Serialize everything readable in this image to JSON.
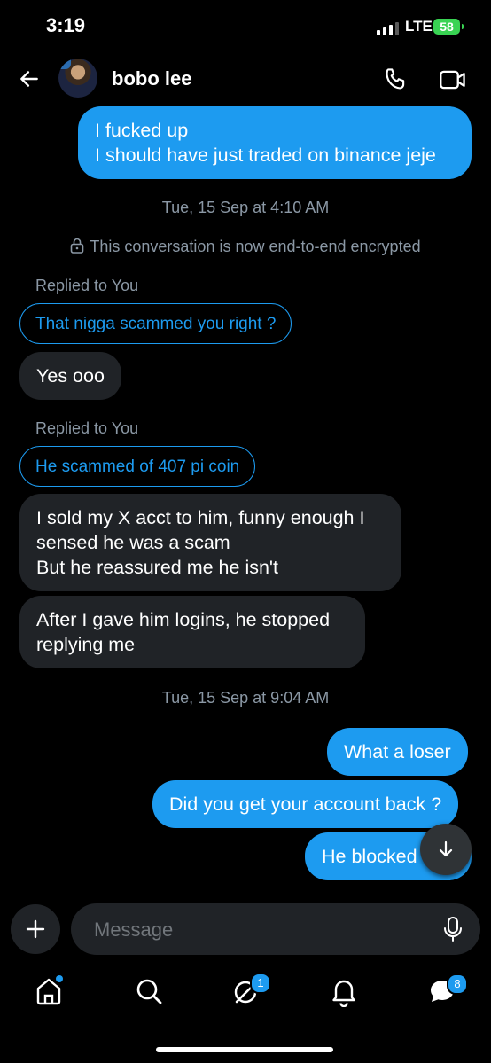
{
  "status": {
    "time": "3:19",
    "network": "LTE",
    "battery": "58"
  },
  "header": {
    "contact_name": "bobo lee"
  },
  "messages": {
    "m1": "I fucked up\nI should have just traded on binance jeje",
    "date1": "Tue, 15 Sep at 4:10 AM",
    "encryption_notice": "This conversation is now end-to-end encrypted",
    "reply1_label": "Replied to You",
    "reply1_quote": "That nigga scammed you right ?",
    "m2": "Yes ooo",
    "reply2_label": "Replied to You",
    "reply2_quote": "He scammed of 407 pi coin",
    "m3": "I sold my X acct to him, funny enough I\nsensed he was a scam\nBut he reassured me he isn't",
    "m4": "After I gave him logins, he stopped\nreplying me",
    "date2": "Tue, 15 Sep at 9:04 AM",
    "m5": "What a loser",
    "m6": "Did you get your account back ?",
    "m7": "He blocked"
  },
  "composer": {
    "placeholder": "Message"
  },
  "nav": {
    "notifications_badge": "1",
    "messages_badge": "8"
  },
  "colors": {
    "accent": "#1d9bf0",
    "incoming_bubble": "#202327",
    "background": "#000000"
  }
}
